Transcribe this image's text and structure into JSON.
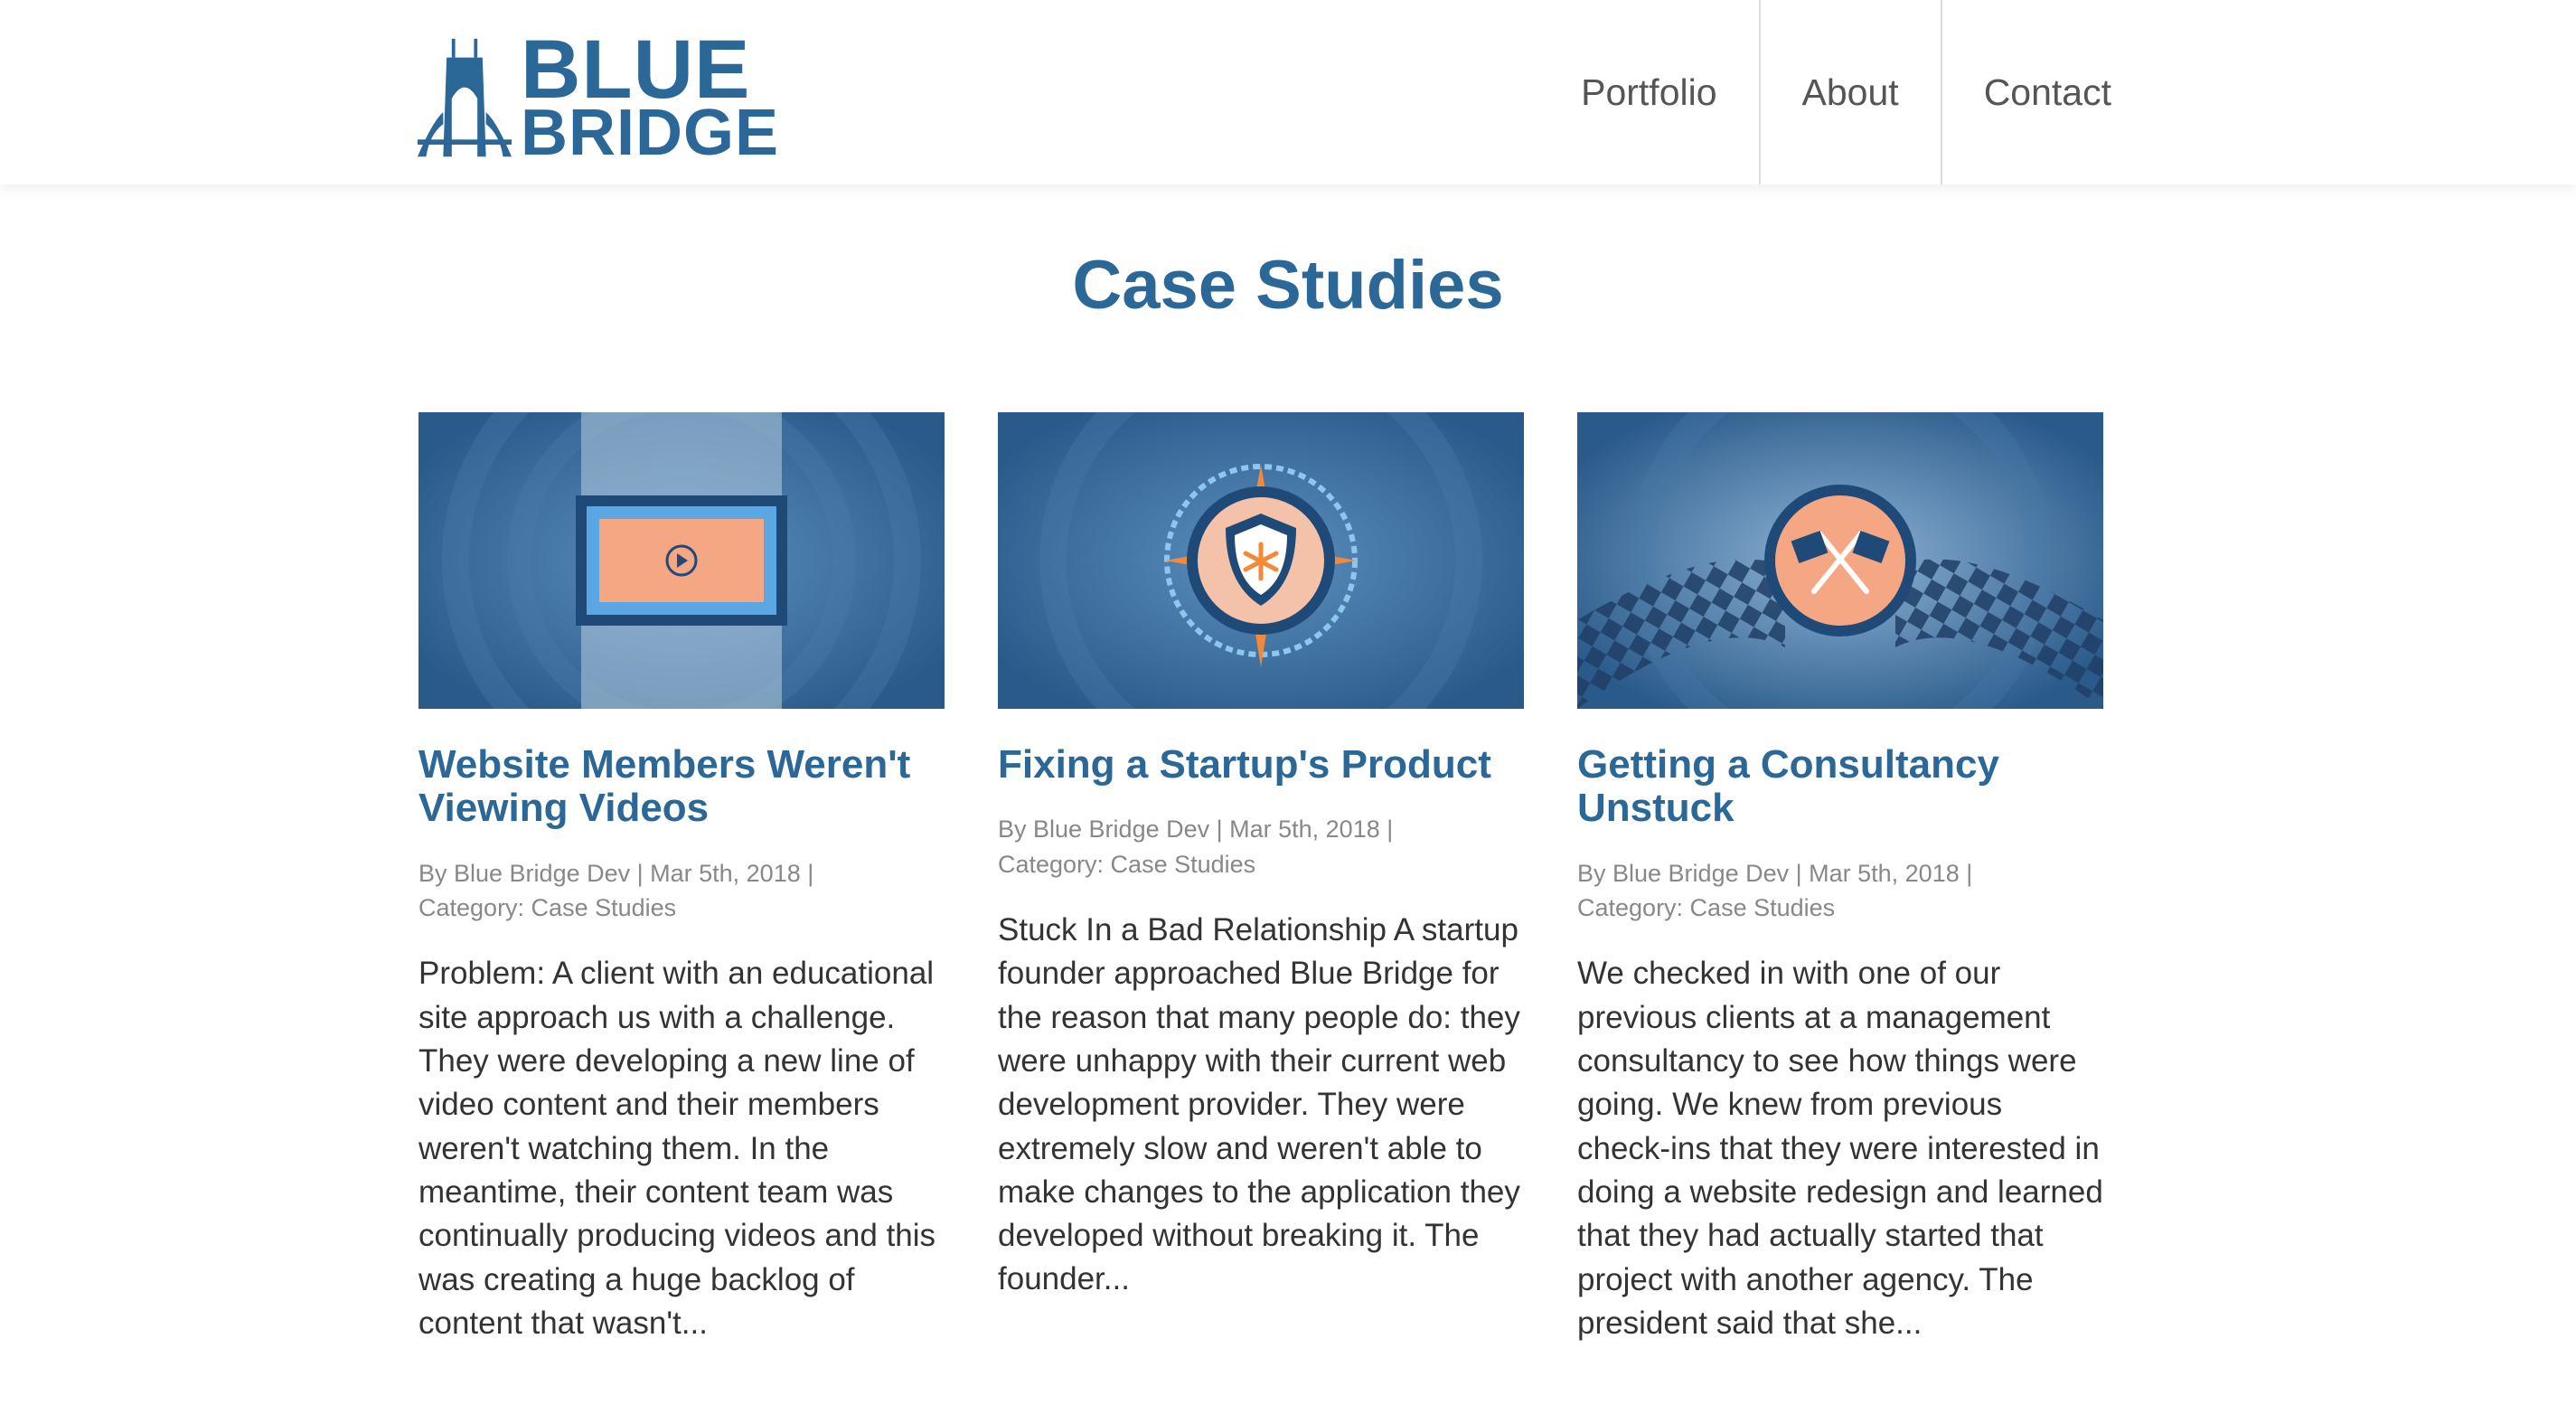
{
  "brand": {
    "line1": "BLUE",
    "line2": "BRIDGE",
    "color": "#2b6797"
  },
  "nav": [
    "Portfolio",
    "About",
    "Contact"
  ],
  "page": {
    "title": "Case Studies"
  },
  "cards": [
    {
      "title": "Website Members Weren't Viewing Videos",
      "meta_line1": "By Blue Bridge Dev | Mar 5th, 2018 |",
      "meta_line2": "Category: Case Studies",
      "excerpt": "Problem: A client with an educational site approach us with a challenge. They were developing a new line of video content and their members weren't watching them. In the meantime, their content team was continually producing videos and this was creating a huge backlog of content that wasn't...",
      "image_icon": "video-player-icon"
    },
    {
      "title": "Fixing a Startup's Product",
      "meta_line1": "By Blue Bridge Dev | Mar 5th, 2018 |",
      "meta_line2": "Category: Case Studies",
      "excerpt": "Stuck In a Bad Relationship A startup founder approached Blue Bridge for the reason that many people do: they were unhappy with their current web development provider. They were extremely slow and weren't able to make changes to the application they developed without breaking it. The founder...",
      "image_icon": "compass-shield-icon"
    },
    {
      "title": "Getting a Consultancy Unstuck",
      "meta_line1": "By Blue Bridge Dev | Mar 5th, 2018 |",
      "meta_line2": "Category: Case Studies",
      "excerpt": "We checked in with one of our previous clients at a management consultancy to see how things were going. We knew from previous check-ins that they were interested in doing a website redesign and learned that they had actually started that project with another agency. The president said that she...",
      "image_icon": "checkered-flags-icon"
    }
  ],
  "colors": {
    "heading": "#2b6797",
    "accent_orange": "#f28a3a",
    "image_bg": "#2f5d8c"
  }
}
